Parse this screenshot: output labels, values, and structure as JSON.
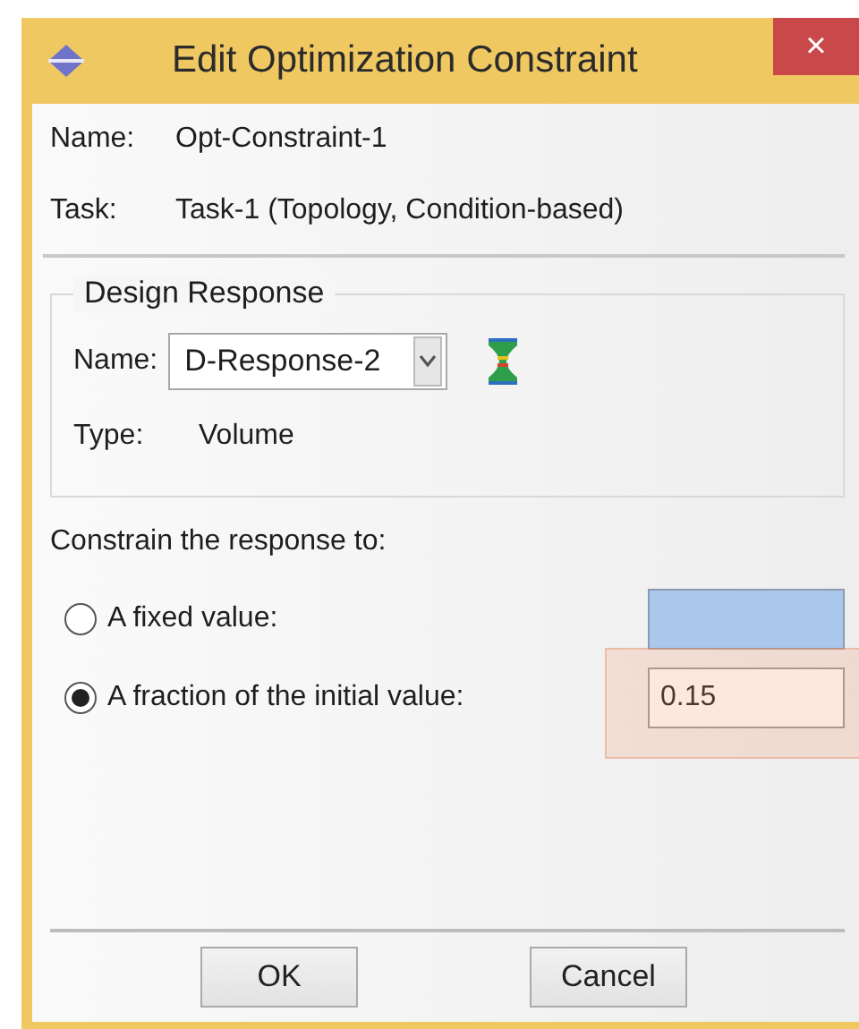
{
  "window": {
    "title": "Edit Optimization Constraint",
    "close": "×"
  },
  "fields": [
    {
      "label": "Name:",
      "value": "Opt-Constraint-1"
    },
    {
      "label": "Task:",
      "value": "Task-1 (Topology, Condition-based)"
    }
  ],
  "design_response": {
    "title": "Design Response",
    "name_label": "Name:",
    "name_value": "D-Response-2",
    "type_label": "Type:",
    "type_value": "Volume"
  },
  "constrain": {
    "label": "Constrain the response to:",
    "options": [
      {
        "label": "A fixed value:",
        "selected": false,
        "highlighted": false
      },
      {
        "label": "A fraction of the initial value:",
        "selected": true,
        "value": "0.15",
        "highlighted": true
      }
    ]
  },
  "buttons": [
    "OK",
    "Cancel"
  ]
}
